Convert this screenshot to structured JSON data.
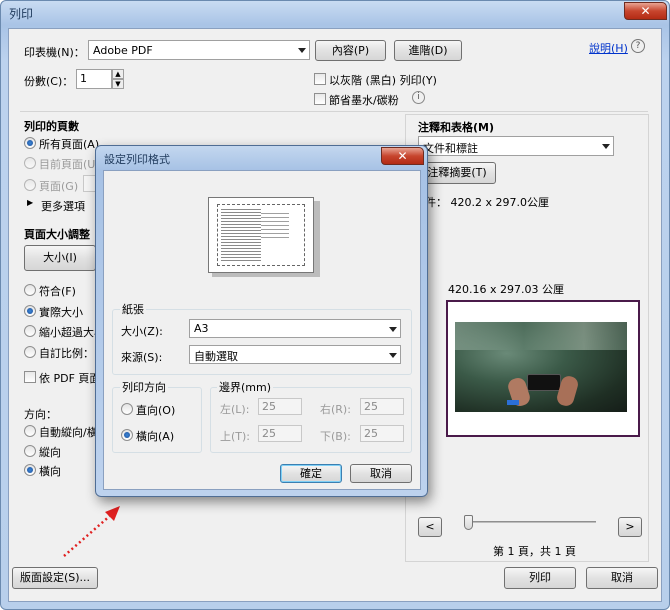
{
  "window": {
    "title": "列印",
    "close": "✕"
  },
  "printer": {
    "label": "印表機(N)：",
    "value": "Adobe PDF",
    "properties": "內容(P)",
    "advanced": "進階(D)",
    "help": "說明(H)"
  },
  "copies": {
    "label": "份數(C)：",
    "value": "1"
  },
  "options": {
    "grayscale": "以灰階 (黑白) 列印(Y)",
    "save_ink": "節省墨水/碳粉"
  },
  "pages": {
    "heading": "列印的頁數",
    "all": "所有頁面(A)",
    "current": "目前頁面(U)",
    "pages": "頁面(G)",
    "more": "更多選項"
  },
  "sizing": {
    "heading": "頁面大小調整",
    "size_btn": "大小(I)",
    "fit": "符合(F)",
    "actual": "實際大小",
    "shrink": "縮小超過大小",
    "custom": "自訂比例：",
    "pdf_paper": "依 PDF 頁面"
  },
  "orientation": {
    "heading": "方向：",
    "auto": "自動縱向/橫",
    "portrait": "縱向",
    "landscape": "橫向"
  },
  "comments": {
    "heading": "注釋和表格(M)",
    "value": "文件和標註",
    "summary_btn": "注釋摘要(T)"
  },
  "preview": {
    "doc_label": "件：  420.2 x 297.0公厘",
    "size_label": "420.16 x 297.03 公厘",
    "nav_prev": "<",
    "nav_next": ">",
    "page_text": "第 1 頁，共 1 頁"
  },
  "footer": {
    "page_setup": "版面設定(S)...",
    "print": "列印",
    "cancel": "取消"
  },
  "dialog": {
    "title": "設定列印格式",
    "close": "✕",
    "paper_group": "紙張",
    "size_label": "大小(Z):",
    "size_value": "A3",
    "source_label": "來源(S):",
    "source_value": "自動選取",
    "orient_group": "列印方向",
    "portrait": "直向(O)",
    "landscape": "橫向(A)",
    "margin_group": "邊界(mm)",
    "left_label": "左(L):",
    "right_label": "右(R):",
    "top_label": "上(T):",
    "bottom_label": "下(B):",
    "left_value": "25",
    "right_value": "25",
    "top_value": "25",
    "bottom_value": "25",
    "ok": "確定",
    "cancel": "取消"
  },
  "colors": {
    "accent": "#3c7fb1",
    "arrow": "#e02020",
    "preview_border": "#4a1a4a"
  }
}
